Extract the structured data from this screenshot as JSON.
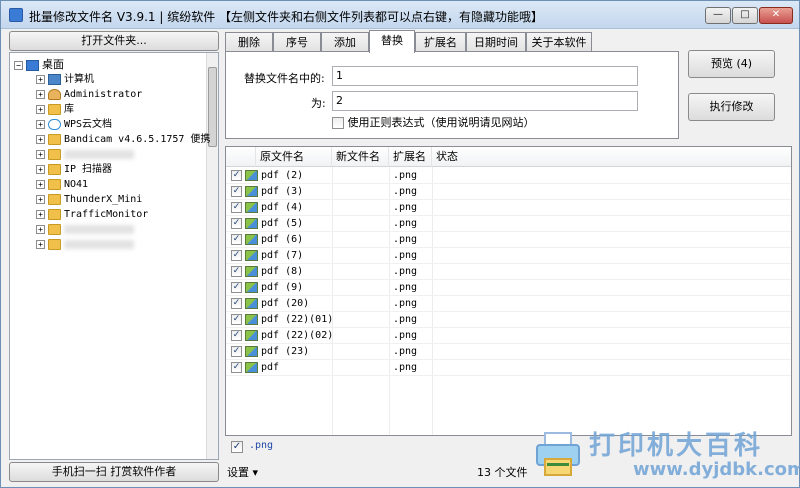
{
  "window": {
    "title": "批量修改文件名 V3.9.1 | 缤纷软件  【左侧文件夹和右侧文件列表都可以点右键，有隐藏功能哦】",
    "min_glyph": "—",
    "max_glyph": "□",
    "close_glyph": "✕"
  },
  "left_panel": {
    "open_folder_label": "打开文件夹...",
    "scan_button_label": "手机扫一扫 打赏软件作者",
    "tree": [
      {
        "label": "桌面",
        "icon": "desktop-icon",
        "level": 0,
        "expander": "−"
      },
      {
        "label": "计算机",
        "icon": "computer-icon",
        "level": 1,
        "expander": "+"
      },
      {
        "label": "Administrator",
        "icon": "user-folder-icon",
        "level": 1,
        "expander": "+"
      },
      {
        "label": "库",
        "icon": "library-folder-icon",
        "level": 1,
        "expander": "+"
      },
      {
        "label": "WPS云文档",
        "icon": "cloud-icon",
        "level": 1,
        "expander": "+"
      },
      {
        "label": "Bandicam  v4.6.5.1757 便携",
        "icon": "folder-icon",
        "level": 1,
        "expander": "+"
      },
      {
        "label": "",
        "icon": "folder-icon",
        "level": 1,
        "expander": "+",
        "blurred": true
      },
      {
        "label": "IP 扫描器",
        "icon": "folder-icon",
        "level": 1,
        "expander": "+"
      },
      {
        "label": "NO41",
        "icon": "folder-icon",
        "level": 1,
        "expander": "+"
      },
      {
        "label": "ThunderX_Mini",
        "icon": "folder-icon",
        "level": 1,
        "expander": "+"
      },
      {
        "label": "TrafficMonitor",
        "icon": "folder-icon",
        "level": 1,
        "expander": "+"
      },
      {
        "label": "",
        "icon": "folder-icon",
        "level": 1,
        "expander": "+",
        "blurred": true
      },
      {
        "label": "",
        "icon": "folder-icon",
        "level": 1,
        "expander": "+",
        "blurred": true
      }
    ]
  },
  "tabs": [
    {
      "label": "删除",
      "active": false
    },
    {
      "label": "序号",
      "active": false
    },
    {
      "label": "添加",
      "active": false
    },
    {
      "label": "替换",
      "active": true
    },
    {
      "label": "扩展名",
      "active": false
    },
    {
      "label": "日期时间",
      "active": false
    },
    {
      "label": "关于本软件",
      "active": false
    }
  ],
  "replace_panel": {
    "find_label": "替换文件名中的:",
    "find_value": "1",
    "replace_label": "为:",
    "replace_value": "2",
    "regex_label": "使用正则表达式（使用说明请见网站）",
    "regex_checked": false
  },
  "actions": {
    "preview_label": "预览 (4)",
    "execute_label": "执行修改"
  },
  "file_list": {
    "columns": [
      "原文件名",
      "新文件名",
      "扩展名",
      "状态"
    ],
    "rows": [
      {
        "original": "pdf (2)",
        "new": "",
        "ext": ".png",
        "status": "",
        "checked": true
      },
      {
        "original": "pdf (3)",
        "new": "",
        "ext": ".png",
        "status": "",
        "checked": true
      },
      {
        "original": "pdf (4)",
        "new": "",
        "ext": ".png",
        "status": "",
        "checked": true
      },
      {
        "original": "pdf (5)",
        "new": "",
        "ext": ".png",
        "status": "",
        "checked": true
      },
      {
        "original": "pdf (6)",
        "new": "",
        "ext": ".png",
        "status": "",
        "checked": true
      },
      {
        "original": "pdf (7)",
        "new": "",
        "ext": ".png",
        "status": "",
        "checked": true
      },
      {
        "original": "pdf (8)",
        "new": "",
        "ext": ".png",
        "status": "",
        "checked": true
      },
      {
        "original": "pdf (9)",
        "new": "",
        "ext": ".png",
        "status": "",
        "checked": true
      },
      {
        "original": "pdf (20)",
        "new": "",
        "ext": ".png",
        "status": "",
        "checked": true
      },
      {
        "original": "pdf (22)(01)",
        "new": "",
        "ext": ".png",
        "status": "",
        "checked": true
      },
      {
        "original": "pdf (22)(02)",
        "new": "",
        "ext": ".png",
        "status": "",
        "checked": true
      },
      {
        "original": "pdf (23)",
        "new": "",
        "ext": ".png",
        "status": "",
        "checked": true
      },
      {
        "original": "pdf",
        "new": "",
        "ext": ".png",
        "status": "",
        "checked": true
      }
    ]
  },
  "ext_filter": {
    "label": ".png",
    "checked": true
  },
  "status_bar": {
    "settings_label": "设置 ▾",
    "file_count": "13 个文件"
  },
  "watermark": {
    "text": "打印机大百科",
    "url": "www.dyjdbk.com"
  }
}
